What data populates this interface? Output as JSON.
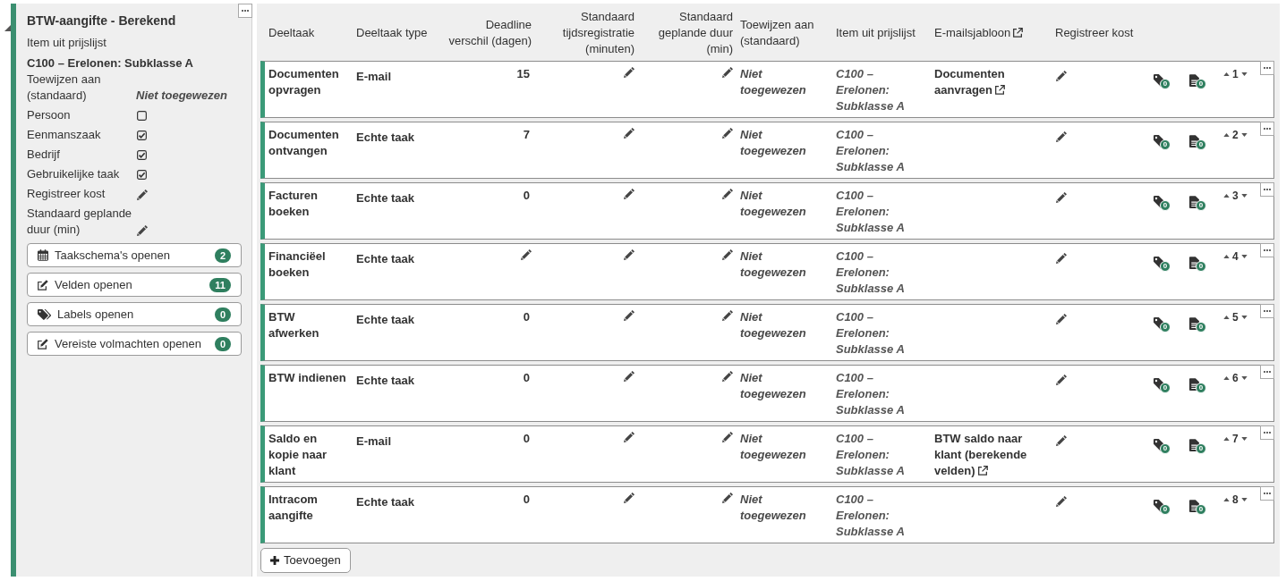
{
  "task": {
    "expanded": true,
    "title": "BTW-aangifte - Berekend",
    "price_item_label": "Item uit prijslijst",
    "price_item": "C100 – Erelonen: Subklasse A",
    "properties": [
      {
        "kind": "value",
        "label": "Toewijzen aan (standaard)",
        "value": "Niet toegewezen"
      },
      {
        "kind": "checkbox",
        "label": "Persoon",
        "checked": false
      },
      {
        "kind": "checkbox",
        "label": "Eenmanszaak",
        "checked": true
      },
      {
        "kind": "checkbox",
        "label": "Bedrijf",
        "checked": true
      },
      {
        "kind": "checkbox",
        "label": "Gebruikelijke taak",
        "checked": true
      },
      {
        "kind": "edit",
        "label": "Registreer kost"
      },
      {
        "kind": "edit",
        "label": "Standaard geplande duur (min)"
      }
    ],
    "buttons": [
      {
        "kind": "calendar",
        "label": "Taakschema's openen",
        "count": "2"
      },
      {
        "kind": "form",
        "label": "Velden openen",
        "count": "11"
      },
      {
        "kind": "tags",
        "label": "Labels openen",
        "count": "0"
      },
      {
        "kind": "form",
        "label": "Vereiste volmachten openen",
        "count": "0"
      }
    ]
  },
  "subtasks": {
    "columns": [
      {
        "label": "Deeltaak"
      },
      {
        "label": "Deeltaak type"
      },
      {
        "label": "Deadline verschil (dagen)"
      },
      {
        "label": "Standaard tijdsregistratie (minuten)"
      },
      {
        "label": "Standaard geplande duur (min)"
      },
      {
        "label": "Toewijzen aan (standaard)"
      },
      {
        "label": "Item uit prijslijst"
      },
      {
        "label": "E-mailsjabloon",
        "external_link": true
      },
      {
        "label": "Registreer kost"
      }
    ],
    "rows": [
      {
        "name": "Documenten opvragen",
        "type": "E-mail",
        "deadline": "15",
        "assignee": "Niet toegewezen",
        "price_item": "C100 – Erelonen: Subklasse A",
        "email_template": "Documenten aanvragen",
        "labels_count": "0",
        "documents_count": "0",
        "order": "1"
      },
      {
        "name": "Documenten ontvangen",
        "type": "Echte taak",
        "deadline": "7",
        "assignee": "Niet toegewezen",
        "price_item": "C100 – Erelonen: Subklasse A",
        "labels_count": "0",
        "documents_count": "0",
        "order": "2"
      },
      {
        "name": "Facturen boeken",
        "type": "Echte taak",
        "deadline": "0",
        "assignee": "Niet toegewezen",
        "price_item": "C100 – Erelonen: Subklasse A",
        "labels_count": "0",
        "documents_count": "0",
        "order": "3"
      },
      {
        "name": "Financiëel boeken",
        "type": "Echte taak",
        "assignee": "Niet toegewezen",
        "price_item": "C100 – Erelonen: Subklasse A",
        "labels_count": "0",
        "documents_count": "0",
        "order": "4"
      },
      {
        "name": "BTW afwerken",
        "type": "Echte taak",
        "deadline": "0",
        "assignee": "Niet toegewezen",
        "price_item": "C100 – Erelonen: Subklasse A",
        "labels_count": "0",
        "documents_count": "0",
        "order": "5"
      },
      {
        "name": "BTW indienen",
        "type": "Echte taak",
        "deadline": "0",
        "assignee": "Niet toegewezen",
        "price_item": "C100 – Erelonen: Subklasse A",
        "labels_count": "0",
        "documents_count": "0",
        "order": "6"
      },
      {
        "name": "Saldo en kopie naar klant",
        "type": "E-mail",
        "deadline": "0",
        "assignee": "Niet toegewezen",
        "price_item": "C100 – Erelonen: Subklasse A",
        "email_template": "BTW saldo naar klant (berekende velden)",
        "labels_count": "0",
        "documents_count": "0",
        "order": "7"
      },
      {
        "name": "Intracom aangifte",
        "type": "Echte taak",
        "deadline": "0",
        "assignee": "Niet toegewezen",
        "price_item": "C100 – Erelonen: Subklasse A",
        "labels_count": "0",
        "documents_count": "0",
        "order": "8"
      }
    ],
    "add_button": "Toevoegen"
  }
}
